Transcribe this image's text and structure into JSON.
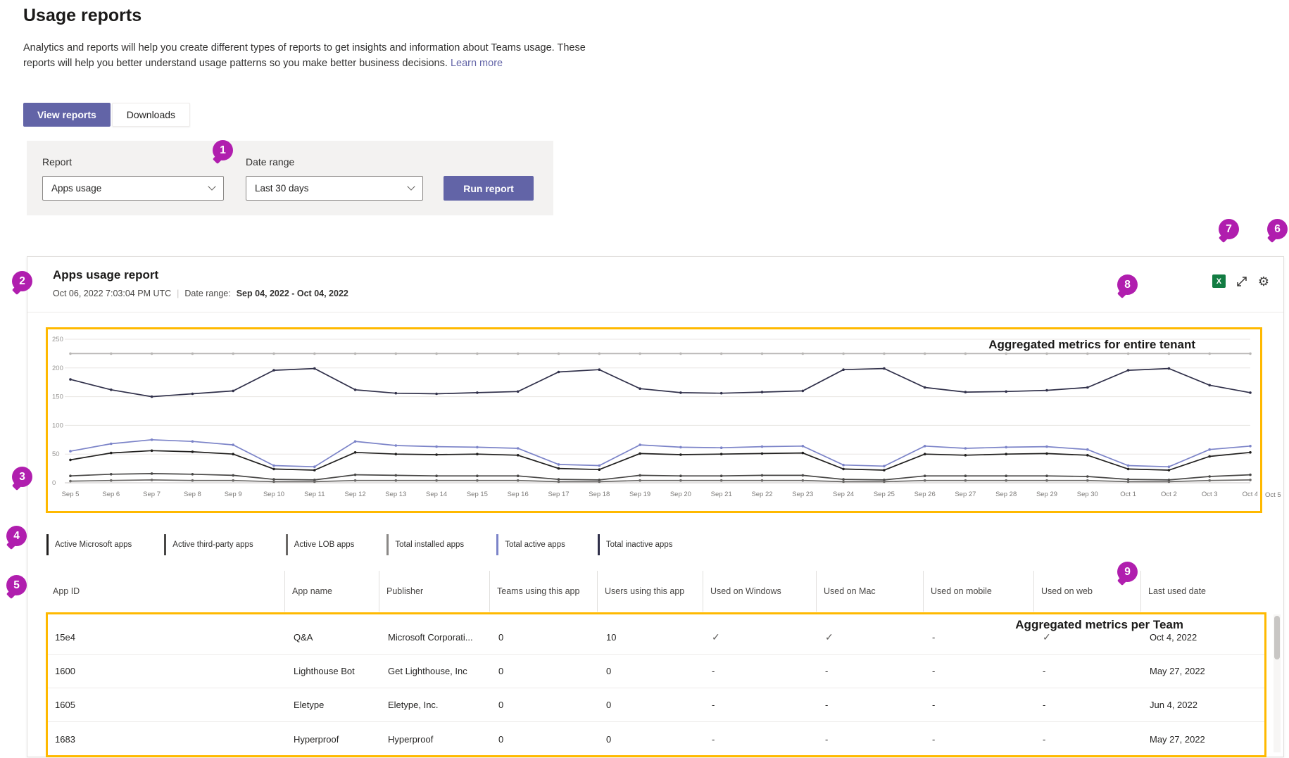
{
  "colors": {
    "accent": "#6264a7",
    "badge": "#b01eae",
    "highlight": "#ffb900",
    "excel": "#127c42"
  },
  "page": {
    "title": "Usage reports",
    "description": "Analytics and reports will help you create different types of reports to get insights and information about Teams usage. These reports will help you better understand usage patterns so you make better business decisions.",
    "learn_more": "Learn more"
  },
  "tabs": [
    {
      "label": "View reports",
      "active": true
    },
    {
      "label": "Downloads",
      "active": false
    }
  ],
  "filters": {
    "report_label": "Report",
    "report_value": "Apps usage",
    "date_range_label": "Date range",
    "date_range_value": "Last 30 days",
    "run_button": "Run report"
  },
  "report": {
    "title": "Apps usage report",
    "generated": "Oct 06, 2022 7:03:04 PM UTC",
    "separator": "|",
    "date_range_label": "Date range:",
    "date_range_value": "Sep 04, 2022 - Oct 04, 2022"
  },
  "icons": {
    "excel": "X",
    "settings": "⚙"
  },
  "annotations": {
    "chart": "Aggregated metrics for entire tenant",
    "table": "Aggregated metrics per Team",
    "badges": [
      "1",
      "2",
      "3",
      "4",
      "5",
      "6",
      "7",
      "8",
      "9"
    ]
  },
  "legend": [
    {
      "label": "Active Microsoft apps",
      "color": "#201f1e"
    },
    {
      "label": "Active third-party apps",
      "color": "#494847"
    },
    {
      "label": "Active LOB apps",
      "color": "#6b6967"
    },
    {
      "label": "Total installed apps",
      "color": "#8a8886"
    },
    {
      "label": "Total active apps",
      "color": "#7b83c8"
    },
    {
      "label": "Total inactive apps",
      "color": "#30304a"
    }
  ],
  "chart_data": {
    "type": "line",
    "title": "Apps usage report",
    "xlabel": "",
    "ylabel": "",
    "ylim": [
      0,
      250
    ],
    "yticks": [
      0,
      50,
      100,
      150,
      200,
      250
    ],
    "grid": true,
    "legend_position": "bottom",
    "overflow_label": "Oct 5",
    "x_labels": [
      "Sep 5",
      "Sep 6",
      "Sep 7",
      "Sep 8",
      "Sep 9",
      "Sep 10",
      "Sep 11",
      "Sep 12",
      "Sep 13",
      "Sep 14",
      "Sep 15",
      "Sep 16",
      "Sep 17",
      "Sep 18",
      "Sep 19",
      "Sep 20",
      "Sep 21",
      "Sep 22",
      "Sep 23",
      "Sep 24",
      "Sep 25",
      "Sep 26",
      "Sep 27",
      "Sep 28",
      "Sep 29",
      "Sep 30",
      "Oct 1",
      "Oct 2",
      "Oct 3",
      "Oct 4"
    ],
    "series": [
      {
        "name": "Total installed apps",
        "color": "#b8b6b4",
        "values": [
          225,
          225,
          225,
          225,
          225,
          225,
          225,
          225,
          225,
          225,
          225,
          225,
          225,
          225,
          225,
          225,
          225,
          225,
          225,
          225,
          225,
          225,
          225,
          225,
          225,
          225,
          225,
          225,
          225,
          225
        ]
      },
      {
        "name": "Total inactive apps",
        "color": "#30304a",
        "values": [
          180,
          162,
          150,
          155,
          160,
          196,
          199,
          162,
          156,
          155,
          157,
          159,
          193,
          197,
          164,
          157,
          156,
          158,
          160,
          197,
          199,
          166,
          158,
          159,
          161,
          166,
          196,
          199,
          170,
          157
        ]
      },
      {
        "name": "Total active apps",
        "color": "#7b83c8",
        "values": [
          55,
          68,
          75,
          72,
          66,
          30,
          28,
          72,
          65,
          63,
          62,
          60,
          32,
          30,
          66,
          62,
          61,
          63,
          64,
          31,
          29,
          64,
          60,
          62,
          63,
          58,
          30,
          28,
          58,
          64
        ]
      },
      {
        "name": "Active Microsoft apps",
        "color": "#201f1e",
        "values": [
          40,
          52,
          56,
          54,
          50,
          24,
          22,
          53,
          50,
          49,
          50,
          48,
          25,
          23,
          51,
          49,
          50,
          51,
          52,
          24,
          22,
          50,
          48,
          50,
          51,
          48,
          24,
          22,
          46,
          53
        ]
      },
      {
        "name": "Active third-party apps",
        "color": "#494847",
        "values": [
          12,
          15,
          16,
          15,
          13,
          6,
          5,
          14,
          13,
          12,
          12,
          12,
          6,
          5,
          13,
          12,
          12,
          13,
          13,
          6,
          5,
          12,
          12,
          12,
          12,
          11,
          6,
          5,
          11,
          14
        ]
      },
      {
        "name": "Active LOB apps",
        "color": "#6b6967",
        "values": [
          3,
          4,
          5,
          4,
          4,
          2,
          2,
          4,
          4,
          4,
          4,
          4,
          2,
          2,
          4,
          4,
          4,
          4,
          4,
          2,
          2,
          4,
          4,
          4,
          4,
          4,
          2,
          2,
          4,
          5
        ]
      }
    ]
  },
  "table": {
    "columns": [
      "App ID",
      "App name",
      "Publisher",
      "Teams using this app",
      "Users using this app",
      "Used on Windows",
      "Used on Mac",
      "Used on mobile",
      "Used on web",
      "Last used date"
    ],
    "rows": [
      [
        "15e4",
        "Q&A",
        "Microsoft Corporati...",
        "0",
        "10",
        "✓",
        "✓",
        "-",
        "✓",
        "Oct 4, 2022"
      ],
      [
        "1600",
        "Lighthouse Bot",
        "Get Lighthouse, Inc",
        "0",
        "0",
        "-",
        "-",
        "-",
        "-",
        "May 27, 2022"
      ],
      [
        "1605",
        "Eletype",
        "Eletype, Inc.",
        "0",
        "0",
        "-",
        "-",
        "-",
        "-",
        "Jun 4, 2022"
      ],
      [
        "1683",
        "Hyperproof",
        "Hyperproof",
        "0",
        "0",
        "-",
        "-",
        "-",
        "-",
        "May 27, 2022"
      ]
    ]
  }
}
